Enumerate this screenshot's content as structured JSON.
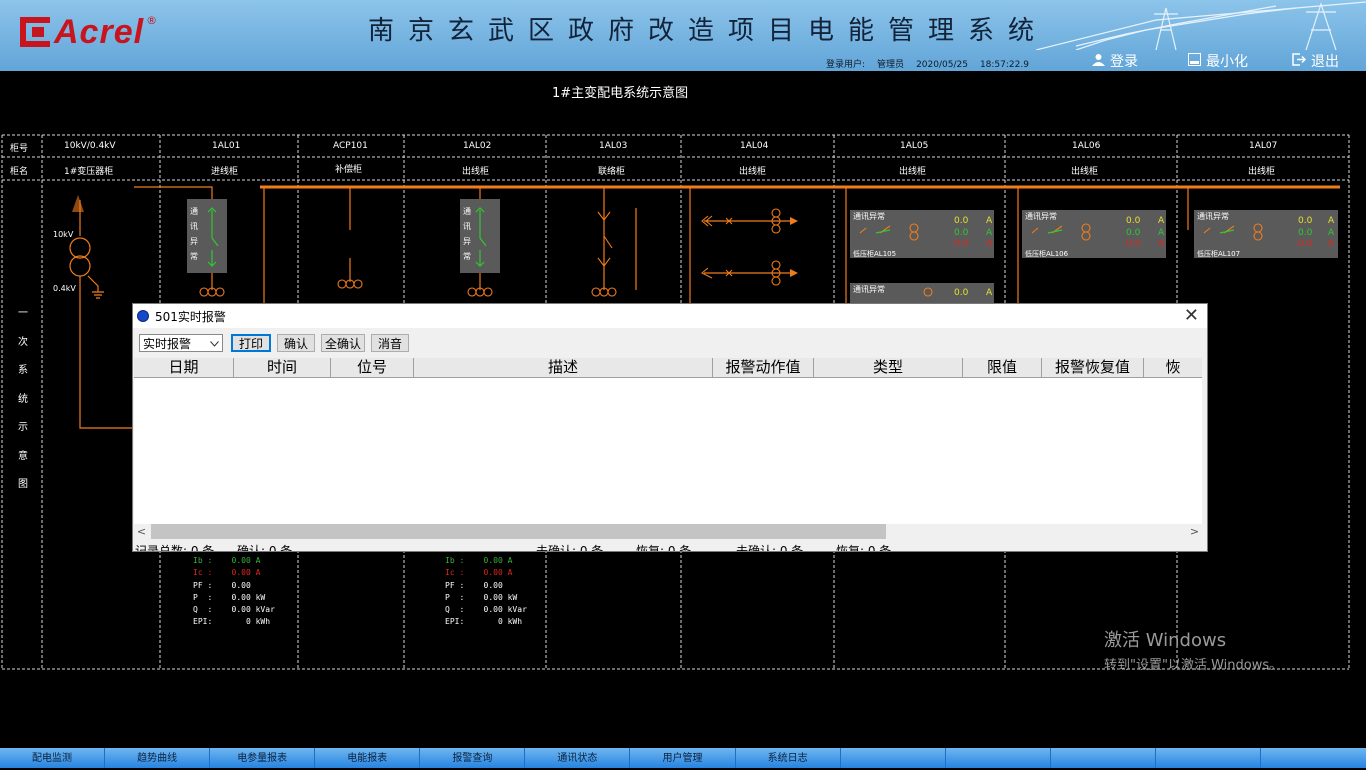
{
  "header": {
    "brand": "Acrel",
    "reg_mark": "®",
    "title": "南京玄武区政府改造项目电能管理系统",
    "user_label": "登录用户:",
    "user_name": "管理员",
    "date": "2020/05/25",
    "time": "18:57:22.9",
    "login": "登录",
    "minimize": "最小化",
    "exit": "退出",
    "bg_color": "#6aabdc",
    "brand_color": "#c8141e"
  },
  "diagram": {
    "title": "1#主变配电系统示意图",
    "row_labels": [
      "柜号",
      "柜名"
    ],
    "side_label": [
      "一",
      "次",
      "系",
      "统",
      "示",
      "意",
      "图"
    ],
    "cabinets": [
      {
        "no": "10kV/0.4kV",
        "name": "1#变压器柜"
      },
      {
        "no": "1AL01",
        "name": "进线柜"
      },
      {
        "no": "ACP101",
        "name": "补偿柜"
      },
      {
        "no": "1AL02",
        "name": "出线柜"
      },
      {
        "no": "1AL03",
        "name": "联络柜"
      },
      {
        "no": "1AL04",
        "name": "出线柜"
      },
      {
        "no": "1AL05",
        "name": "出线柜"
      },
      {
        "no": "1AL06",
        "name": "出线柜"
      },
      {
        "no": "1AL07",
        "name": "出线柜"
      }
    ],
    "transformer": {
      "hv": "10kV",
      "lv": "0.4kV"
    },
    "comm_fault": [
      "通",
      "讯",
      "异",
      "常"
    ],
    "panels": [
      {
        "status": "通讯异常",
        "name": "低压柜AL105",
        "values": [
          "0.0",
          "0.0",
          "0.0"
        ],
        "unit": "A"
      },
      {
        "status": "通讯异常",
        "name": "低压柜AL106",
        "values": [
          "0.0",
          "0.0",
          "0.0"
        ],
        "unit": "A"
      },
      {
        "status": "通讯异常",
        "name": "低压柜AL107",
        "values": [
          "0.0",
          "0.0",
          "0.0"
        ],
        "unit": "A"
      },
      {
        "status": "通讯异常",
        "name": "",
        "values": [
          "0.0"
        ],
        "unit": "A"
      }
    ],
    "line_color": "#f07c1c",
    "meters": [
      {
        "ib": "Ib :    0.00 A",
        "ic": "Ic :    0.00 A",
        "pf": "PF :    0.00",
        "p": "P  :    0.00 kW",
        "q": "Q  :    0.00 kVar",
        "epi": "EPI:       0 kWh"
      },
      {
        "ib": "Ib :    0.00 A",
        "ic": "Ic :    0.00 A",
        "pf": "PF :    0.00",
        "p": "P  :    0.00 kW",
        "q": "Q  :    0.00 kVar",
        "epi": "EPI:       0 kWh"
      }
    ]
  },
  "dialog": {
    "title": "501实时报警",
    "close": "✕",
    "filter_value": "实时报警",
    "buttons": {
      "print": "打印",
      "confirm": "确认",
      "confirm_all": "全确认",
      "mute": "消音"
    },
    "columns": [
      "日期",
      "时间",
      "位号",
      "描述",
      "报警动作值",
      "类型",
      "限值",
      "报警恢复值",
      "恢"
    ],
    "status": {
      "total": "记录总数: 0 条",
      "confirmed": "确认: 0 条",
      "unconfirmed1": "未确认: 0 条",
      "recovered1": "恢复: 0 条",
      "unconfirmed2": "未确认: 0 条",
      "recovered2": "恢复: 0 条"
    }
  },
  "watermark": {
    "line1": "激活 Windows",
    "line2": "转到\"设置\"以激活 Windows。"
  },
  "taskbar": [
    "配电监测",
    "趋势曲线",
    "电参量报表",
    "电能报表",
    "报警查询",
    "通讯状态",
    "用户管理",
    "系统日志",
    "",
    "",
    "",
    "",
    ""
  ]
}
